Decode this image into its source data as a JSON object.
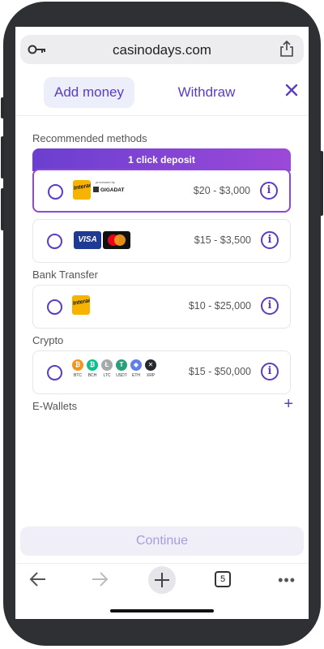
{
  "browser": {
    "url": "casinodays.com",
    "open_tabs_count": "5"
  },
  "header": {
    "tab_add_money": "Add money",
    "tab_withdraw": "Withdraw"
  },
  "sections": {
    "recommended": "Recommended methods",
    "bank_transfer": "Bank Transfer",
    "crypto": "Crypto",
    "ewallets": "E-Wallets"
  },
  "ribbon": "1 click deposit",
  "methods": [
    {
      "range": "$20 - $3,000",
      "logos": [
        "Interac",
        "GIGADAT"
      ],
      "logo_caption": "processed by"
    },
    {
      "range": "$15 - $3,500",
      "logos": [
        "VISA",
        "mastercard"
      ]
    },
    {
      "range": "$10 - $25,000",
      "logos": [
        "Interac"
      ]
    },
    {
      "range": "$15 - $50,000",
      "logos": [
        "BTC",
        "BCH",
        "LTC",
        "USDT",
        "ETH",
        "XRP"
      ]
    }
  ],
  "crypto_coins": [
    "BTC",
    "BCH",
    "LTC",
    "USDT",
    "ETH",
    "XRP"
  ],
  "continue_label": "Continue",
  "colors": {
    "accent": "#5b3cc4",
    "ribbon_start": "#6b3fd0",
    "ribbon_end": "#9c49d8",
    "btc": "#f7931a",
    "bch": "#0ac18e",
    "ltc": "#a6a9aa",
    "usdt": "#26a17b",
    "eth": "#627eea",
    "xrp": "#23292f"
  },
  "icons": {
    "key": "key-icon",
    "share": "share-icon",
    "close": "close-icon",
    "info": "info-icon",
    "back": "back-arrow-icon",
    "forward": "forward-arrow-icon",
    "new_tab": "plus-icon",
    "menu": "more-dots-icon"
  }
}
